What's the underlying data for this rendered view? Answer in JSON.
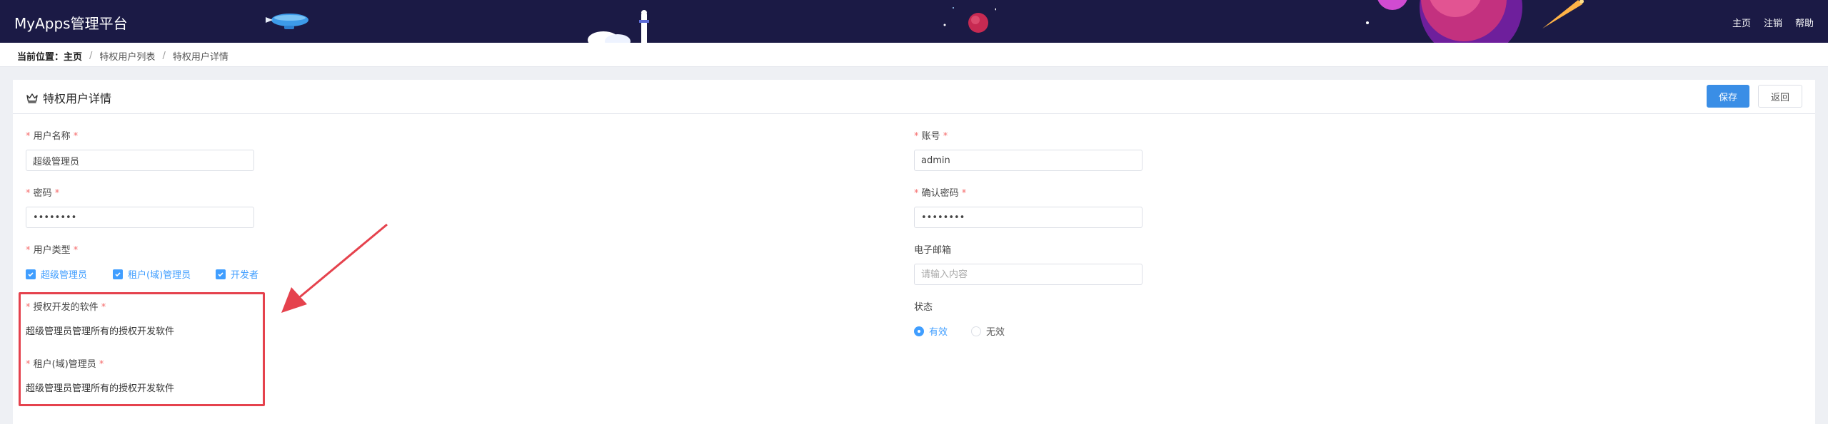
{
  "app": {
    "title": "MyApps管理平台"
  },
  "topnav": {
    "home": "主页",
    "logout": "注销",
    "help": "帮助"
  },
  "breadcrumb": {
    "lead": "当前位置：",
    "home": "主页",
    "sep": "/",
    "list": "特权用户列表",
    "detail": "特权用户详情"
  },
  "panel": {
    "title": "特权用户详情",
    "save": "保存",
    "back": "返回"
  },
  "form": {
    "username": {
      "label": "用户名称",
      "value": "超级管理员"
    },
    "account": {
      "label": "账号",
      "value": "admin"
    },
    "password": {
      "label": "密码",
      "value": "••••••••"
    },
    "confirm": {
      "label": "确认密码",
      "value": "••••••••"
    },
    "usertype": {
      "label": "用户类型",
      "options": [
        "超级管理员",
        "租户(域)管理员",
        "开发者"
      ]
    },
    "email": {
      "label": "电子邮箱",
      "placeholder": "请输入内容"
    },
    "software": {
      "label": "授权开发的软件",
      "value": "超级管理员管理所有的授权开发软件"
    },
    "tenant": {
      "label": "租户(域)管理员",
      "value": "超级管理员管理所有的授权开发软件"
    },
    "status": {
      "label": "状态",
      "options": [
        "有效",
        "无效"
      ]
    }
  },
  "colors": {
    "header": "#1b1a45",
    "primary": "#409eff",
    "annotation": "#e5424d"
  }
}
